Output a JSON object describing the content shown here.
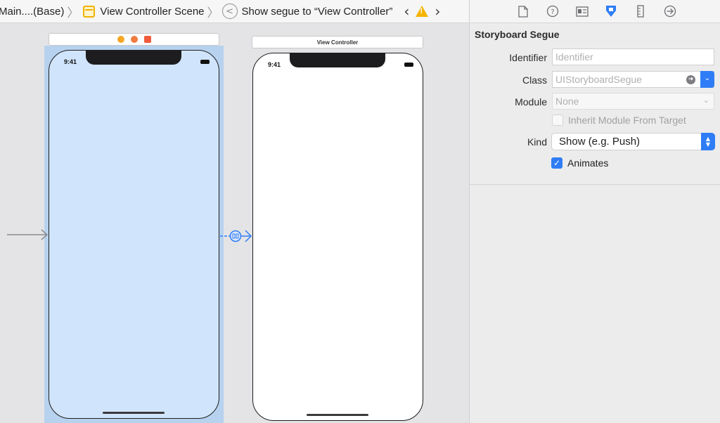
{
  "jumpbar": {
    "file_label": "Main....(Base)",
    "scene_label": "View Controller Scene",
    "segue_label": "Show segue to “View Controller”",
    "icons": [
      "scene-icon",
      "segue-icon",
      "back-arrow-icon",
      "warning-icon",
      "forward-arrow-icon"
    ]
  },
  "canvas": {
    "left_device": {
      "time": "9:41"
    },
    "right_device": {
      "title": "View Controller",
      "time": "9:41"
    },
    "scene_dock_icons": [
      "first-responder-icon",
      "exit-icon",
      "view-controller-icon"
    ],
    "colors": {
      "selection": "#b7d2ef",
      "segue": "#2f7df6"
    }
  },
  "inspector": {
    "tabs": [
      "file-inspector-icon",
      "quick-help-icon",
      "identity-inspector-icon",
      "attributes-inspector-icon",
      "size-inspector-icon",
      "connections-inspector-icon"
    ],
    "section_title": "Storyboard Segue",
    "identifier": {
      "label": "Identifier",
      "placeholder": "Identifier",
      "value": ""
    },
    "class_field": {
      "label": "Class",
      "placeholder": "UIStoryboardSegue"
    },
    "module": {
      "label": "Module",
      "placeholder": "None"
    },
    "inherit_module": {
      "label": "Inherit Module From Target",
      "checked": false
    },
    "kind": {
      "label": "Kind",
      "value": "Show (e.g. Push)"
    },
    "animates": {
      "label": "Animates",
      "checked": true
    },
    "accent": "#2f7df6"
  }
}
